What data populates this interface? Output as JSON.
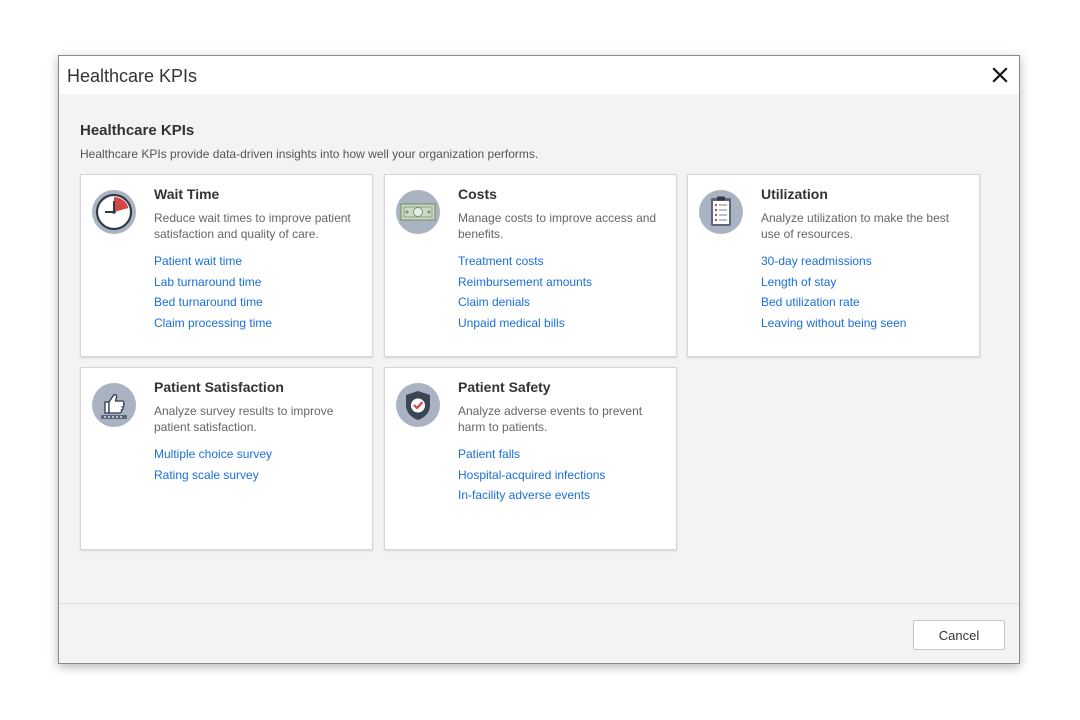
{
  "dialog": {
    "title": "Healthcare KPIs",
    "close_label": "×"
  },
  "content": {
    "heading": "Healthcare KPIs",
    "description": "Healthcare KPIs provide data-driven insights into how well your organization performs."
  },
  "cards": [
    {
      "title": "Wait Time",
      "description": "Reduce wait times to improve patient satisfaction and quality of care.",
      "icon": "clock-icon",
      "links": [
        "Patient wait time",
        "Lab turnaround time",
        "Bed turnaround time",
        "Claim processing time"
      ]
    },
    {
      "title": "Costs",
      "description": "Manage costs to improve access and benefits.",
      "icon": "money-icon",
      "links": [
        "Treatment costs",
        "Reimbursement amounts",
        "Claim denials",
        "Unpaid medical bills"
      ]
    },
    {
      "title": "Utilization",
      "description": "Analyze utilization to make the best use of resources.",
      "icon": "clipboard-icon",
      "links": [
        "30-day readmissions",
        "Length of stay",
        "Bed utilization rate",
        "Leaving without being seen"
      ]
    },
    {
      "title": "Patient Satisfaction",
      "description": "Analyze survey results to improve patient satisfaction.",
      "icon": "thumbs-up-icon",
      "links": [
        "Multiple choice survey",
        "Rating scale survey"
      ]
    },
    {
      "title": "Patient Safety",
      "description": "Analyze adverse events to prevent harm to patients.",
      "icon": "shield-check-icon",
      "links": [
        "Patient falls",
        "Hospital-acquired infections",
        "In-facility adverse events"
      ]
    }
  ],
  "footer": {
    "cancel_label": "Cancel"
  },
  "colors": {
    "link": "#1a6fd9",
    "icon_circle": "#a9b3c1",
    "accent_red": "#d64545"
  }
}
